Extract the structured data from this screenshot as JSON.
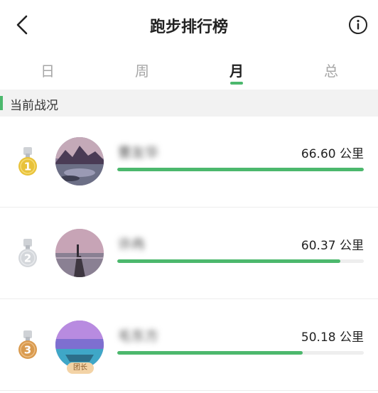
{
  "header": {
    "title": "跑步排行榜",
    "back_icon": "chevron-left-icon",
    "info_icon": "info-circle-icon"
  },
  "tabs": [
    {
      "label": "日",
      "active": false
    },
    {
      "label": "周",
      "active": false
    },
    {
      "label": "月",
      "active": true
    },
    {
      "label": "总",
      "active": false
    }
  ],
  "section": {
    "title": "当前战况"
  },
  "colors": {
    "accent": "#4cb86d",
    "gold": "#e8c23a",
    "silver": "#cfd2d6",
    "bronze": "#d99a4e"
  },
  "leaderboard": [
    {
      "rank": "1",
      "medal": "gold-medal-icon",
      "name": "曹友华",
      "distance": "66.60 公里",
      "progress": 1.0,
      "badge": ""
    },
    {
      "rank": "2",
      "medal": "silver-medal-icon",
      "name": "许冉",
      "distance": "60.37 公里",
      "progress": 0.906,
      "badge": ""
    },
    {
      "rank": "3",
      "medal": "bronze-medal-icon",
      "name": "毛东方",
      "distance": "50.18 公里",
      "progress": 0.753,
      "badge": "团长"
    }
  ]
}
